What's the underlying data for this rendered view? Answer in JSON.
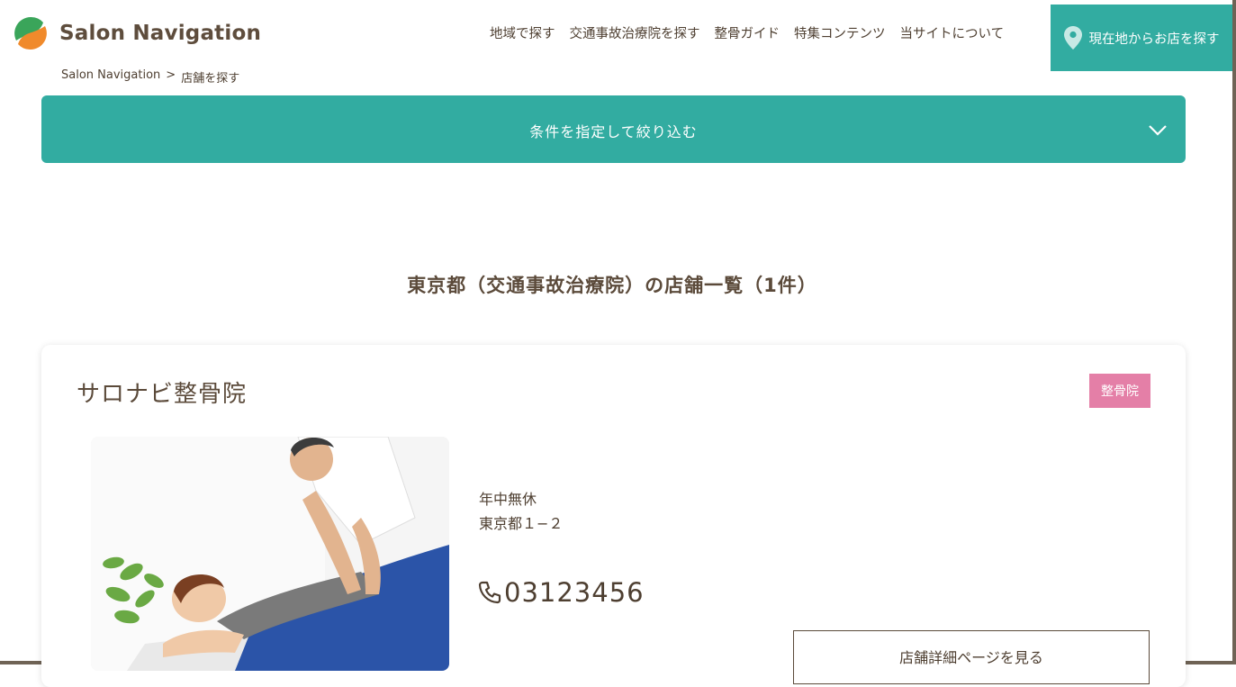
{
  "header": {
    "logo_text": "Salon Navigation",
    "nav": [
      "地域で探す",
      "交通事故治療院を探す",
      "整骨ガイド",
      "特集コンテンツ",
      "当サイトについて"
    ],
    "location_button": "現在地からお店を探す"
  },
  "breadcrumb": {
    "home": "Salon Navigation",
    "separator": ">",
    "current": "店舗を探す"
  },
  "filter": {
    "label": "条件を指定して絞り込む"
  },
  "list": {
    "heading": "東京都（交通事故治療院）の店舗一覧（1件）"
  },
  "shop": {
    "name": "サロナビ整骨院",
    "category": "整骨院",
    "hours": "年中無休",
    "address": "東京都１−２",
    "phone": "03123456",
    "detail_button": "店舗詳細ページを見る"
  },
  "colors": {
    "accent": "#32aca1",
    "badge": "#e47fa7",
    "text": "#5b4a3a"
  },
  "icons": [
    "logo-mark",
    "map-pin-icon",
    "chevron-down-icon",
    "phone-icon"
  ]
}
